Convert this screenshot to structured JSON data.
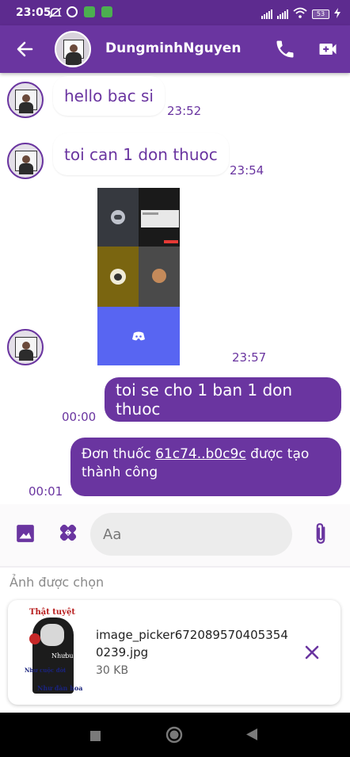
{
  "status_bar": {
    "time": "23:05",
    "battery": "53"
  },
  "header": {
    "contact_name": "DungminhNguyen",
    "back_icon": "arrow-left-icon",
    "call_icon": "phone-icon",
    "video_icon": "video-camera-icon"
  },
  "messages": [
    {
      "direction": "in",
      "text": "hello bac si",
      "time": "23:52"
    },
    {
      "direction": "in",
      "text": "toi can 1 don thuoc",
      "time": "23:54"
    },
    {
      "direction": "in",
      "type": "image",
      "time": "23:57"
    },
    {
      "direction": "out",
      "text": "toi se cho 1 ban 1 don thuoc",
      "time": "00:00"
    },
    {
      "direction": "out",
      "text_prefix": "Đơn thuốc ",
      "link": "61c74..b0c9c",
      "text_suffix": " được tạo thành công",
      "time": "00:01"
    }
  ],
  "composer": {
    "placeholder": "Aa",
    "value": ""
  },
  "picked": {
    "label": "Ảnh được chọn",
    "file_name": "image_picker6720895704053540239.jpg",
    "file_size": "30 KB",
    "thumb_caption_top": "Thật tuyệt",
    "thumb_caption_mid": "Nhưbuồi",
    "thumb_caption_left": "Như cuộc đời",
    "thumb_caption_bottom": "Như đàn hoa"
  },
  "colors": {
    "primary": "#6a35a0",
    "status_bar": "#5d2b8f"
  }
}
